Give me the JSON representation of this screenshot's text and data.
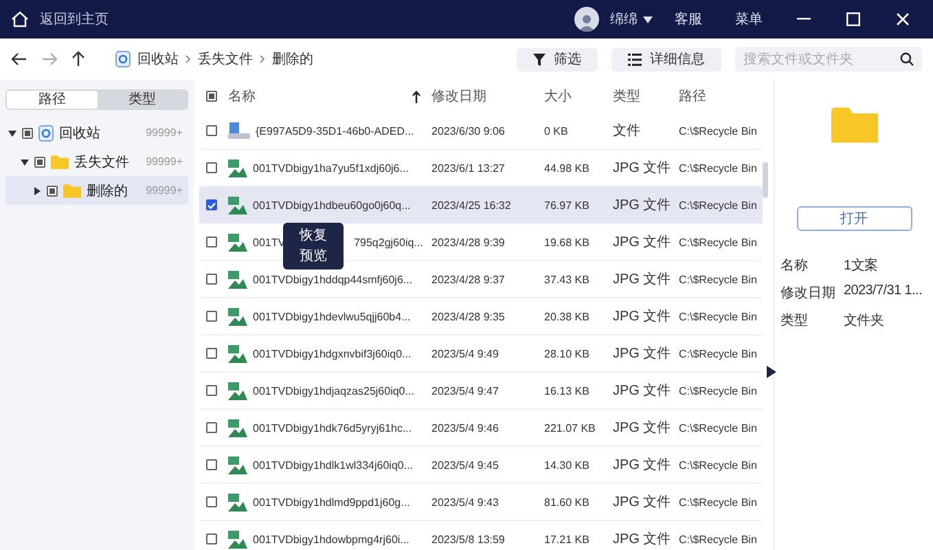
{
  "title_bar": {
    "home_label": "返回到主页",
    "user": "绵绵",
    "links": [
      "客服",
      "菜单"
    ]
  },
  "toolbar": {
    "back_disabled": false,
    "forward_disabled": true,
    "breadcrumb": [
      "回收站",
      "丢失文件",
      "删除的"
    ],
    "filter": "筛选",
    "details": "详细信息",
    "search": {
      "placeholder": "搜索文件或文件夹"
    }
  },
  "sidebar": {
    "tabs": [
      {
        "label": "路径",
        "selected": true
      },
      {
        "label": "类型",
        "selected": false
      }
    ],
    "tree": [
      {
        "label": "回收站",
        "count": "99999+",
        "kind": "recycle",
        "expanded": true,
        "selected": false,
        "mixed": true,
        "children": [
          {
            "label": "丢失文件",
            "count": "99999+",
            "kind": "folder",
            "expanded": true,
            "selected": false,
            "mixed": true,
            "children": [
              {
                "label": "删除的",
                "count": "99999+",
                "kind": "folder",
                "expanded": false,
                "selected": true,
                "mixed": true
              }
            ]
          }
        ]
      }
    ]
  },
  "table": {
    "select_all_mixed": true,
    "sort_ascending": true,
    "columns": [
      "名称",
      "修改日期",
      "大小",
      "类型",
      "路径"
    ],
    "rows": [
      {
        "kind": "file",
        "name": "{E997A5D9-35D1-46b0-ADED...",
        "date": "2023/6/30 9:06",
        "size": "0 KB",
        "type": "文件",
        "path": "C:\\$Recycle Bin",
        "selected": false
      },
      {
        "kind": "image",
        "name": "001TVDbigy1ha7yu5f1xdj60j6...",
        "date": "2023/6/1 13:27",
        "size": "44.98 KB",
        "type": "JPG 文件",
        "path": "C:\\$Recycle Bin",
        "selected": false
      },
      {
        "kind": "image",
        "name": "001TVDbigy1hdbeu60go0j60q...",
        "date": "2023/4/25 16:32",
        "size": "76.97 KB",
        "type": "JPG 文件",
        "path": "C:\\$Recycle Bin",
        "selected": true
      },
      {
        "kind": "image",
        "name": "001TV",
        "name_after_menu": "795q2gj60iq...",
        "date": "2023/4/28 9:39",
        "size": "19.68 KB",
        "type": "JPG 文件",
        "path": "C:\\$Recycle Bin",
        "selected": false
      },
      {
        "kind": "image",
        "name": "001TVDbigy1hddqp44smfj60j6...",
        "date": "2023/4/28 9:37",
        "size": "37.43 KB",
        "type": "JPG 文件",
        "path": "C:\\$Recycle Bin",
        "selected": false
      },
      {
        "kind": "image",
        "name": "001TVDbigy1hdevlwu5qjj60b4...",
        "date": "2023/4/28 9:35",
        "size": "20.38 KB",
        "type": "JPG 文件",
        "path": "C:\\$Recycle Bin",
        "selected": false
      },
      {
        "kind": "image",
        "name": "001TVDbigy1hdgxnvbif3j60iq0...",
        "date": "2023/5/4 9:49",
        "size": "28.10 KB",
        "type": "JPG 文件",
        "path": "C:\\$Recycle Bin",
        "selected": false
      },
      {
        "kind": "image",
        "name": "001TVDbigy1hdjaqzas25j60iq0...",
        "date": "2023/5/4 9:47",
        "size": "16.13 KB",
        "type": "JPG 文件",
        "path": "C:\\$Recycle Bin",
        "selected": false
      },
      {
        "kind": "image",
        "name": "001TVDbigy1hdk76d5yryj61hc...",
        "date": "2023/5/4 9:46",
        "size": "221.07 KB",
        "type": "JPG 文件",
        "path": "C:\\$Recycle Bin",
        "selected": false
      },
      {
        "kind": "image",
        "name": "001TVDbigy1hdlk1wl334j60iq0...",
        "date": "2023/5/4 9:45",
        "size": "14.30 KB",
        "type": "JPG 文件",
        "path": "C:\\$Recycle Bin",
        "selected": false
      },
      {
        "kind": "image",
        "name": "001TVDbigy1hdlmd9ppd1j60g...",
        "date": "2023/5/4 9:43",
        "size": "81.60 KB",
        "type": "JPG 文件",
        "path": "C:\\$Recycle Bin",
        "selected": false
      },
      {
        "kind": "image",
        "name": "001TVDbigy1hdowbpmg4rj60i...",
        "date": "2023/5/8 13:59",
        "size": "17.21 KB",
        "type": "JPG 文件",
        "path": "C:\\$Recycle Bin",
        "selected": false
      }
    ]
  },
  "context_menu": [
    "恢复",
    "预览"
  ],
  "details_panel": {
    "open_button": "打开",
    "properties": [
      {
        "label": "名称",
        "value": "1文案"
      },
      {
        "label": "修改日期",
        "value": "2023/7/31 1..."
      },
      {
        "label": "类型",
        "value": "文件夹"
      }
    ]
  }
}
